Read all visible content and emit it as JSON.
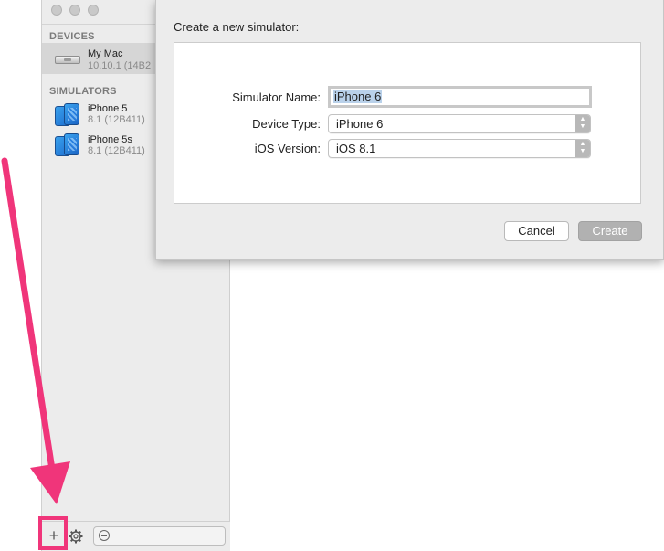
{
  "window": {
    "devices_header": "DEVICES",
    "simulators_header": "SIMULATORS",
    "devices": [
      {
        "name": "My Mac",
        "sub": "10.10.1 (14B2"
      }
    ],
    "simulators": [
      {
        "name": "iPhone 5",
        "sub": "8.1 (12B411)"
      },
      {
        "name": "iPhone 5s",
        "sub": "8.1 (12B411)"
      }
    ],
    "bottom_bar": {
      "add_label": "+"
    }
  },
  "sheet": {
    "title": "Create a new simulator:",
    "fields": {
      "name_label": "Simulator Name:",
      "name_value": "iPhone 6",
      "device_type_label": "Device Type:",
      "device_type_value": "iPhone 6",
      "ios_version_label": "iOS Version:",
      "ios_version_value": "iOS 8.1"
    },
    "cancel_label": "Cancel",
    "create_label": "Create"
  },
  "colors": {
    "annotation": "#f0357a",
    "selection_highlight": "#b9d1ea"
  }
}
